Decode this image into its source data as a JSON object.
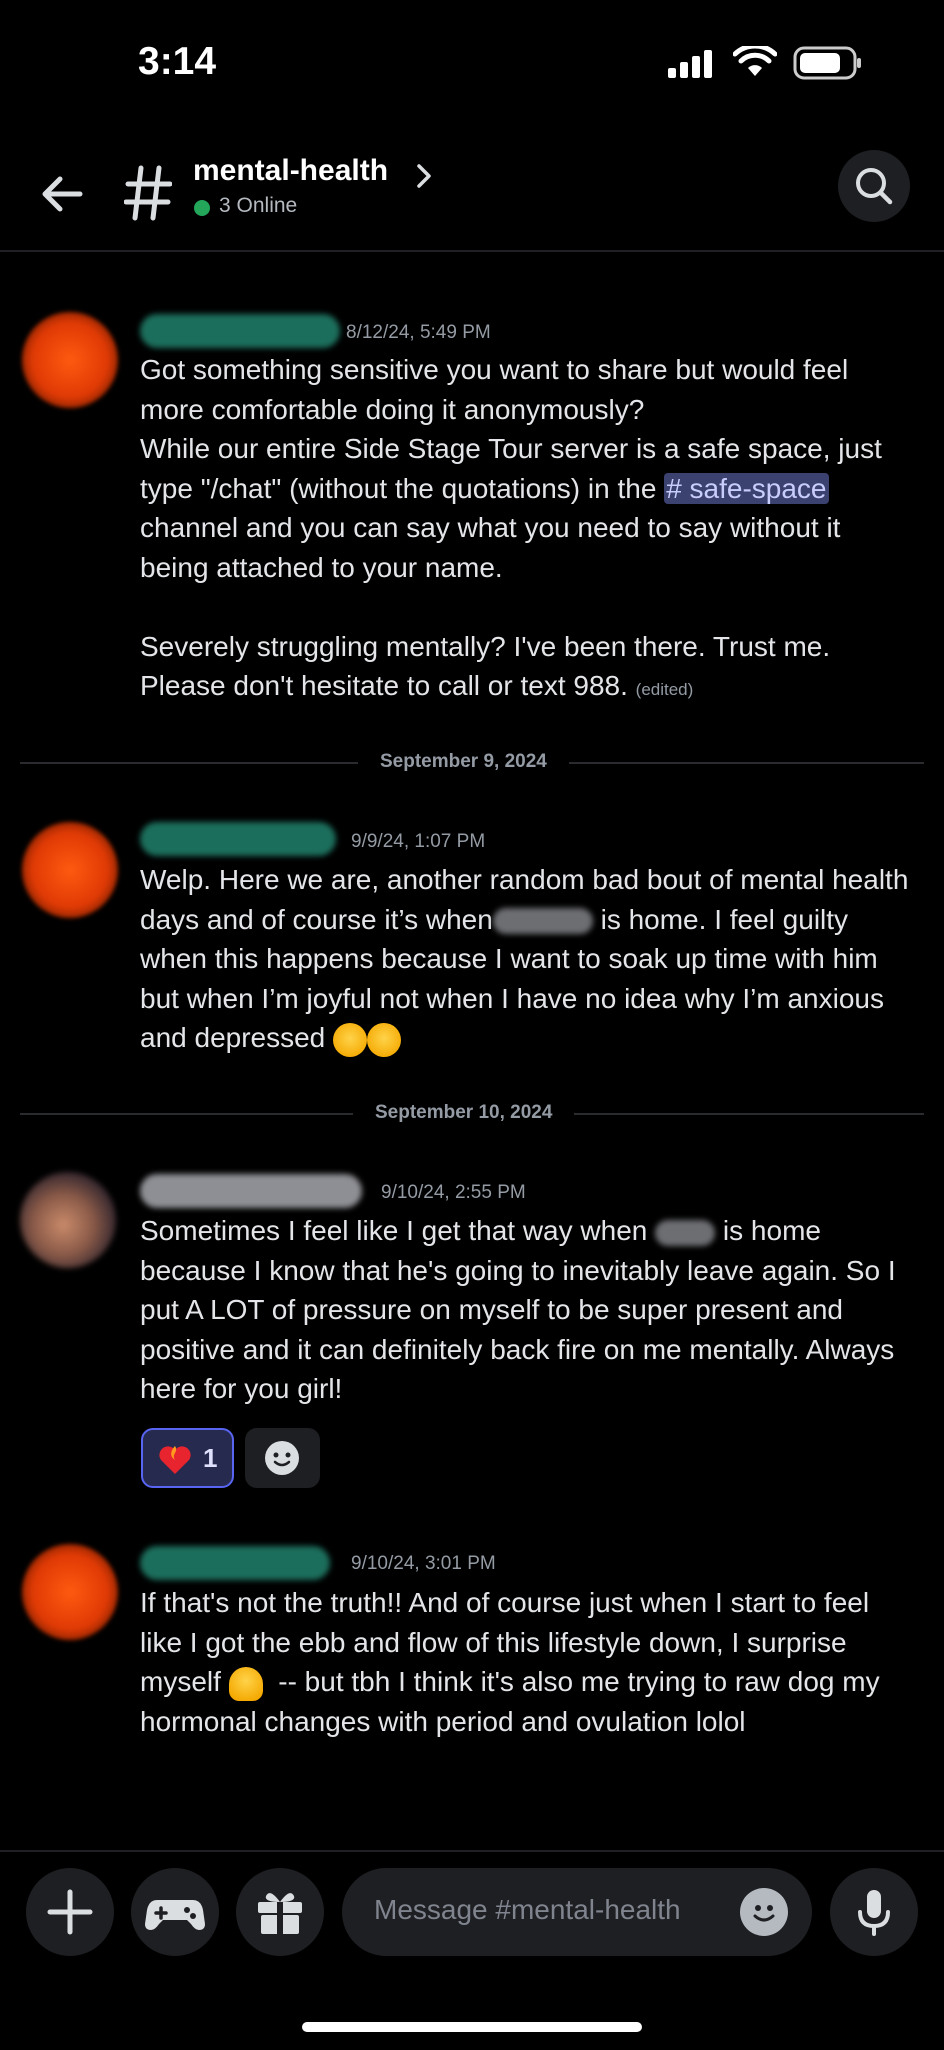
{
  "status_bar": {
    "time": "3:14"
  },
  "header": {
    "channel_name": "mental-health",
    "online": "3 Online"
  },
  "messages": [
    {
      "timestamp": "8/12/24, 5:49 PM",
      "text_1": "Got something sensitive you want to share but would feel more comfortable doing it anonymously?\nWhile our entire Side Stage Tour server is a safe space, just type \"/chat\" (without the quotations) in the ",
      "mention": "# safe-space",
      "text_2": "\nchannel and you can say what you need to say without it being attached to your name.\n\nSeverely struggling mentally? I've been there. Trust me. Please don't hesitate to call or text 988. ",
      "edited": "(edited)"
    },
    {
      "timestamp": "9/9/24, 1:07 PM",
      "text_1": "Welp. Here we are, another random bad bout of mental health days and of course it’s when",
      "text_2": " is home. I feel guilty when this happens because I want to soak up time with him but when I’m joyful not when I have no idea why I’m anxious and depressed "
    },
    {
      "timestamp": "9/10/24, 2:55 PM",
      "text_1": "Sometimes I feel like I get that way when ",
      "text_2": " is home because I know that he's going to inevitably leave again. So I put A LOT of pressure on myself to be super present and positive and it can definitely back fire on me mentally. Always here for you girl!",
      "reaction_count": "1"
    },
    {
      "timestamp": "9/10/24, 3:01 PM",
      "text_1": "If that's not the truth!! And of course just when I start to feel like I got the ebb and flow of this lifestyle down, I surprise myself ",
      "text_2": "  -- but tbh I think it's also me trying to raw dog my hormonal changes with period and ovulation lolol"
    }
  ],
  "dividers": [
    "September 9, 2024",
    "September 10, 2024"
  ],
  "composer": {
    "placeholder": "Message #mental-health"
  },
  "icons": {
    "back": "arrow-left-icon",
    "channel": "hash-icon",
    "search": "search-icon",
    "add": "plus-icon",
    "games": "gamepad-icon",
    "gift": "gift-icon",
    "emoji": "smile-icon",
    "voice": "microphone-icon"
  },
  "colors": {
    "background": "#000000",
    "accent": "#5865f2",
    "online": "#23a55a",
    "mention_bg": "#3c4270"
  }
}
